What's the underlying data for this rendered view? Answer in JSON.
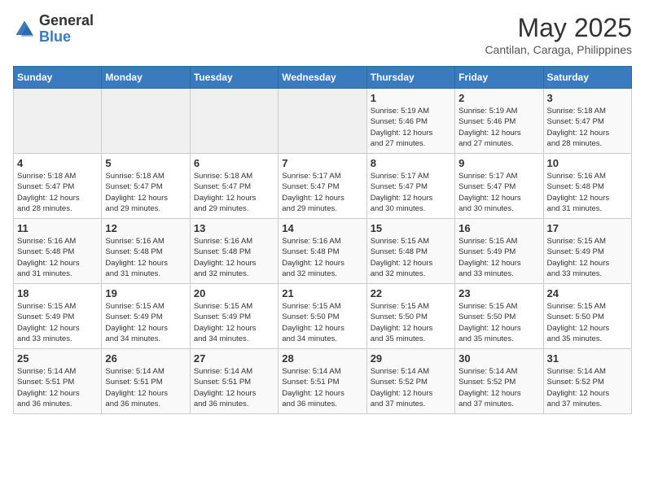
{
  "header": {
    "logo_general": "General",
    "logo_blue": "Blue",
    "month_title": "May 2025",
    "subtitle": "Cantilan, Caraga, Philippines"
  },
  "days_of_week": [
    "Sunday",
    "Monday",
    "Tuesday",
    "Wednesday",
    "Thursday",
    "Friday",
    "Saturday"
  ],
  "weeks": [
    [
      {
        "day": "",
        "info": ""
      },
      {
        "day": "",
        "info": ""
      },
      {
        "day": "",
        "info": ""
      },
      {
        "day": "",
        "info": ""
      },
      {
        "day": "1",
        "info": "Sunrise: 5:19 AM\nSunset: 5:46 PM\nDaylight: 12 hours\nand 27 minutes."
      },
      {
        "day": "2",
        "info": "Sunrise: 5:19 AM\nSunset: 5:46 PM\nDaylight: 12 hours\nand 27 minutes."
      },
      {
        "day": "3",
        "info": "Sunrise: 5:18 AM\nSunset: 5:47 PM\nDaylight: 12 hours\nand 28 minutes."
      }
    ],
    [
      {
        "day": "4",
        "info": "Sunrise: 5:18 AM\nSunset: 5:47 PM\nDaylight: 12 hours\nand 28 minutes."
      },
      {
        "day": "5",
        "info": "Sunrise: 5:18 AM\nSunset: 5:47 PM\nDaylight: 12 hours\nand 29 minutes."
      },
      {
        "day": "6",
        "info": "Sunrise: 5:18 AM\nSunset: 5:47 PM\nDaylight: 12 hours\nand 29 minutes."
      },
      {
        "day": "7",
        "info": "Sunrise: 5:17 AM\nSunset: 5:47 PM\nDaylight: 12 hours\nand 29 minutes."
      },
      {
        "day": "8",
        "info": "Sunrise: 5:17 AM\nSunset: 5:47 PM\nDaylight: 12 hours\nand 30 minutes."
      },
      {
        "day": "9",
        "info": "Sunrise: 5:17 AM\nSunset: 5:47 PM\nDaylight: 12 hours\nand 30 minutes."
      },
      {
        "day": "10",
        "info": "Sunrise: 5:16 AM\nSunset: 5:48 PM\nDaylight: 12 hours\nand 31 minutes."
      }
    ],
    [
      {
        "day": "11",
        "info": "Sunrise: 5:16 AM\nSunset: 5:48 PM\nDaylight: 12 hours\nand 31 minutes."
      },
      {
        "day": "12",
        "info": "Sunrise: 5:16 AM\nSunset: 5:48 PM\nDaylight: 12 hours\nand 31 minutes."
      },
      {
        "day": "13",
        "info": "Sunrise: 5:16 AM\nSunset: 5:48 PM\nDaylight: 12 hours\nand 32 minutes."
      },
      {
        "day": "14",
        "info": "Sunrise: 5:16 AM\nSunset: 5:48 PM\nDaylight: 12 hours\nand 32 minutes."
      },
      {
        "day": "15",
        "info": "Sunrise: 5:15 AM\nSunset: 5:48 PM\nDaylight: 12 hours\nand 32 minutes."
      },
      {
        "day": "16",
        "info": "Sunrise: 5:15 AM\nSunset: 5:49 PM\nDaylight: 12 hours\nand 33 minutes."
      },
      {
        "day": "17",
        "info": "Sunrise: 5:15 AM\nSunset: 5:49 PM\nDaylight: 12 hours\nand 33 minutes."
      }
    ],
    [
      {
        "day": "18",
        "info": "Sunrise: 5:15 AM\nSunset: 5:49 PM\nDaylight: 12 hours\nand 33 minutes."
      },
      {
        "day": "19",
        "info": "Sunrise: 5:15 AM\nSunset: 5:49 PM\nDaylight: 12 hours\nand 34 minutes."
      },
      {
        "day": "20",
        "info": "Sunrise: 5:15 AM\nSunset: 5:49 PM\nDaylight: 12 hours\nand 34 minutes."
      },
      {
        "day": "21",
        "info": "Sunrise: 5:15 AM\nSunset: 5:50 PM\nDaylight: 12 hours\nand 34 minutes."
      },
      {
        "day": "22",
        "info": "Sunrise: 5:15 AM\nSunset: 5:50 PM\nDaylight: 12 hours\nand 35 minutes."
      },
      {
        "day": "23",
        "info": "Sunrise: 5:15 AM\nSunset: 5:50 PM\nDaylight: 12 hours\nand 35 minutes."
      },
      {
        "day": "24",
        "info": "Sunrise: 5:15 AM\nSunset: 5:50 PM\nDaylight: 12 hours\nand 35 minutes."
      }
    ],
    [
      {
        "day": "25",
        "info": "Sunrise: 5:14 AM\nSunset: 5:51 PM\nDaylight: 12 hours\nand 36 minutes."
      },
      {
        "day": "26",
        "info": "Sunrise: 5:14 AM\nSunset: 5:51 PM\nDaylight: 12 hours\nand 36 minutes."
      },
      {
        "day": "27",
        "info": "Sunrise: 5:14 AM\nSunset: 5:51 PM\nDaylight: 12 hours\nand 36 minutes."
      },
      {
        "day": "28",
        "info": "Sunrise: 5:14 AM\nSunset: 5:51 PM\nDaylight: 12 hours\nand 36 minutes."
      },
      {
        "day": "29",
        "info": "Sunrise: 5:14 AM\nSunset: 5:52 PM\nDaylight: 12 hours\nand 37 minutes."
      },
      {
        "day": "30",
        "info": "Sunrise: 5:14 AM\nSunset: 5:52 PM\nDaylight: 12 hours\nand 37 minutes."
      },
      {
        "day": "31",
        "info": "Sunrise: 5:14 AM\nSunset: 5:52 PM\nDaylight: 12 hours\nand 37 minutes."
      }
    ]
  ]
}
